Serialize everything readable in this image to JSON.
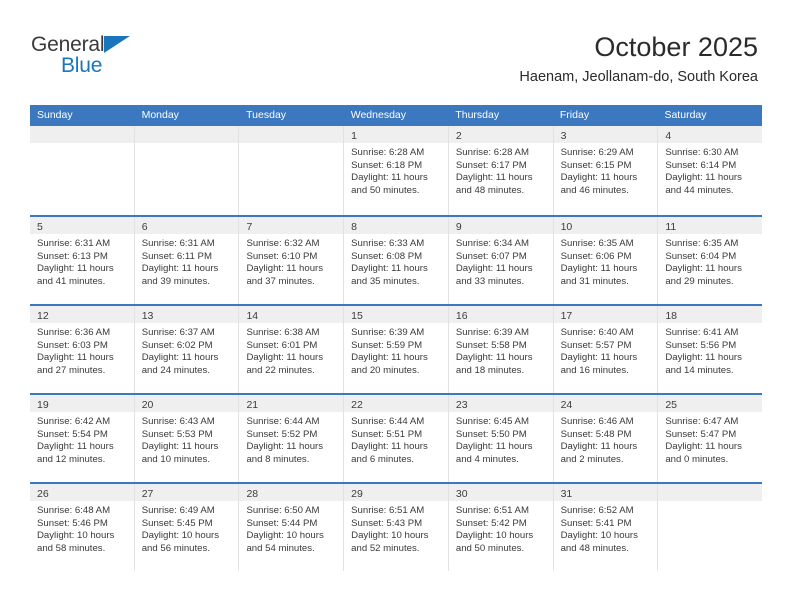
{
  "brand": {
    "name_top": "General",
    "name_bottom": "Blue",
    "accent_color": "#1a76bc"
  },
  "header": {
    "title": "October 2025",
    "subtitle": "Haenam, Jeollanam-do, South Korea"
  },
  "calendar": {
    "header_bg": "#3b78bf",
    "header_text_color": "#ffffff",
    "day_band_bg": "#efefef",
    "weekday_headers": [
      "Sunday",
      "Monday",
      "Tuesday",
      "Wednesday",
      "Thursday",
      "Friday",
      "Saturday"
    ],
    "weeks": [
      [
        {
          "day": "",
          "lines": []
        },
        {
          "day": "",
          "lines": []
        },
        {
          "day": "",
          "lines": []
        },
        {
          "day": "1",
          "lines": [
            "Sunrise: 6:28 AM",
            "Sunset: 6:18 PM",
            "Daylight: 11 hours",
            "and 50 minutes."
          ]
        },
        {
          "day": "2",
          "lines": [
            "Sunrise: 6:28 AM",
            "Sunset: 6:17 PM",
            "Daylight: 11 hours",
            "and 48 minutes."
          ]
        },
        {
          "day": "3",
          "lines": [
            "Sunrise: 6:29 AM",
            "Sunset: 6:15 PM",
            "Daylight: 11 hours",
            "and 46 minutes."
          ]
        },
        {
          "day": "4",
          "lines": [
            "Sunrise: 6:30 AM",
            "Sunset: 6:14 PM",
            "Daylight: 11 hours",
            "and 44 minutes."
          ]
        }
      ],
      [
        {
          "day": "5",
          "lines": [
            "Sunrise: 6:31 AM",
            "Sunset: 6:13 PM",
            "Daylight: 11 hours",
            "and 41 minutes."
          ]
        },
        {
          "day": "6",
          "lines": [
            "Sunrise: 6:31 AM",
            "Sunset: 6:11 PM",
            "Daylight: 11 hours",
            "and 39 minutes."
          ]
        },
        {
          "day": "7",
          "lines": [
            "Sunrise: 6:32 AM",
            "Sunset: 6:10 PM",
            "Daylight: 11 hours",
            "and 37 minutes."
          ]
        },
        {
          "day": "8",
          "lines": [
            "Sunrise: 6:33 AM",
            "Sunset: 6:08 PM",
            "Daylight: 11 hours",
            "and 35 minutes."
          ]
        },
        {
          "day": "9",
          "lines": [
            "Sunrise: 6:34 AM",
            "Sunset: 6:07 PM",
            "Daylight: 11 hours",
            "and 33 minutes."
          ]
        },
        {
          "day": "10",
          "lines": [
            "Sunrise: 6:35 AM",
            "Sunset: 6:06 PM",
            "Daylight: 11 hours",
            "and 31 minutes."
          ]
        },
        {
          "day": "11",
          "lines": [
            "Sunrise: 6:35 AM",
            "Sunset: 6:04 PM",
            "Daylight: 11 hours",
            "and 29 minutes."
          ]
        }
      ],
      [
        {
          "day": "12",
          "lines": [
            "Sunrise: 6:36 AM",
            "Sunset: 6:03 PM",
            "Daylight: 11 hours",
            "and 27 minutes."
          ]
        },
        {
          "day": "13",
          "lines": [
            "Sunrise: 6:37 AM",
            "Sunset: 6:02 PM",
            "Daylight: 11 hours",
            "and 24 minutes."
          ]
        },
        {
          "day": "14",
          "lines": [
            "Sunrise: 6:38 AM",
            "Sunset: 6:01 PM",
            "Daylight: 11 hours",
            "and 22 minutes."
          ]
        },
        {
          "day": "15",
          "lines": [
            "Sunrise: 6:39 AM",
            "Sunset: 5:59 PM",
            "Daylight: 11 hours",
            "and 20 minutes."
          ]
        },
        {
          "day": "16",
          "lines": [
            "Sunrise: 6:39 AM",
            "Sunset: 5:58 PM",
            "Daylight: 11 hours",
            "and 18 minutes."
          ]
        },
        {
          "day": "17",
          "lines": [
            "Sunrise: 6:40 AM",
            "Sunset: 5:57 PM",
            "Daylight: 11 hours",
            "and 16 minutes."
          ]
        },
        {
          "day": "18",
          "lines": [
            "Sunrise: 6:41 AM",
            "Sunset: 5:56 PM",
            "Daylight: 11 hours",
            "and 14 minutes."
          ]
        }
      ],
      [
        {
          "day": "19",
          "lines": [
            "Sunrise: 6:42 AM",
            "Sunset: 5:54 PM",
            "Daylight: 11 hours",
            "and 12 minutes."
          ]
        },
        {
          "day": "20",
          "lines": [
            "Sunrise: 6:43 AM",
            "Sunset: 5:53 PM",
            "Daylight: 11 hours",
            "and 10 minutes."
          ]
        },
        {
          "day": "21",
          "lines": [
            "Sunrise: 6:44 AM",
            "Sunset: 5:52 PM",
            "Daylight: 11 hours",
            "and 8 minutes."
          ]
        },
        {
          "day": "22",
          "lines": [
            "Sunrise: 6:44 AM",
            "Sunset: 5:51 PM",
            "Daylight: 11 hours",
            "and 6 minutes."
          ]
        },
        {
          "day": "23",
          "lines": [
            "Sunrise: 6:45 AM",
            "Sunset: 5:50 PM",
            "Daylight: 11 hours",
            "and 4 minutes."
          ]
        },
        {
          "day": "24",
          "lines": [
            "Sunrise: 6:46 AM",
            "Sunset: 5:48 PM",
            "Daylight: 11 hours",
            "and 2 minutes."
          ]
        },
        {
          "day": "25",
          "lines": [
            "Sunrise: 6:47 AM",
            "Sunset: 5:47 PM",
            "Daylight: 11 hours",
            "and 0 minutes."
          ]
        }
      ],
      [
        {
          "day": "26",
          "lines": [
            "Sunrise: 6:48 AM",
            "Sunset: 5:46 PM",
            "Daylight: 10 hours",
            "and 58 minutes."
          ]
        },
        {
          "day": "27",
          "lines": [
            "Sunrise: 6:49 AM",
            "Sunset: 5:45 PM",
            "Daylight: 10 hours",
            "and 56 minutes."
          ]
        },
        {
          "day": "28",
          "lines": [
            "Sunrise: 6:50 AM",
            "Sunset: 5:44 PM",
            "Daylight: 10 hours",
            "and 54 minutes."
          ]
        },
        {
          "day": "29",
          "lines": [
            "Sunrise: 6:51 AM",
            "Sunset: 5:43 PM",
            "Daylight: 10 hours",
            "and 52 minutes."
          ]
        },
        {
          "day": "30",
          "lines": [
            "Sunrise: 6:51 AM",
            "Sunset: 5:42 PM",
            "Daylight: 10 hours",
            "and 50 minutes."
          ]
        },
        {
          "day": "31",
          "lines": [
            "Sunrise: 6:52 AM",
            "Sunset: 5:41 PM",
            "Daylight: 10 hours",
            "and 48 minutes."
          ]
        },
        {
          "day": "",
          "lines": []
        }
      ]
    ]
  }
}
